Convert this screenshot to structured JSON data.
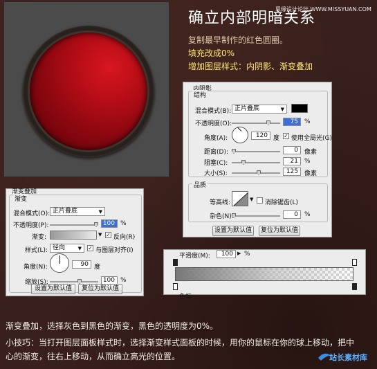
{
  "heading": {
    "title": "确立内部明暗关系",
    "watermark": "思缘设计论坛 WWW.MISSYUAN.COM",
    "line1": "复制最早制作的红色圆圈。",
    "line2": "填充改成0%",
    "line3": "增加图层样式：内阴影、渐变叠加"
  },
  "inner_shadow": {
    "panel_title": "内阴影",
    "struct_title": "结构",
    "blend_label": "混合模式(B):",
    "blend_value": "正片叠底",
    "opacity_label": "不透明度(O):",
    "opacity_value": "75",
    "pct": "%",
    "angle_label": "角度(A):",
    "angle_value": "120",
    "deg": "度",
    "global_light_label": "使用全局光(G)",
    "distance_label": "距离(D):",
    "distance_value": "0",
    "choke_label": "阻塞(C):",
    "choke_value": "21",
    "size_label": "大小(S):",
    "size_value": "125",
    "px": "像素",
    "quality_title": "品质",
    "contour_label": "等高线:",
    "antialias_label": "消除锯齿(L)",
    "noise_label": "杂色(N):",
    "noise_value": "0",
    "default_btn": "设置为默认值",
    "reset_btn": "复位为默认值",
    "color": "#000000"
  },
  "gradient_overlay": {
    "panel_title": "渐变叠加",
    "group_title": "渐变",
    "blend_label": "混合模式(O):",
    "blend_value": "正片叠底",
    "opacity_label": "不透明度(P):",
    "opacity_value": "100",
    "pct": "%",
    "gradient_label": "渐变:",
    "reverse_label": "反向(R)",
    "style_label": "样式(L):",
    "style_value": "径向",
    "align_label": "与图层对齐(I)",
    "angle_label": "角度(N):",
    "angle_value": "90",
    "deg": "度",
    "scale_label": "缩放(S):",
    "scale_value": "100",
    "default_btn": "设置为默认值",
    "reset_btn": "复位为默认值"
  },
  "gradient_editor": {
    "smoothness_label": "平滑度(M):",
    "smoothness_value": "100",
    "pct": "%",
    "color_label": "色标"
  },
  "notes": {
    "note1": "渐变叠加，选择灰色到黑色的渐变，黑色的透明度为0%。",
    "note2": "小技巧：当打开图层面板样式时，选择渐变样式面板的时候，用你的鼠标在你的球上移动，把中心的渐变，往右上移动，从而确立高光的位置。"
  },
  "logo": {
    "text": "站长素材库"
  }
}
